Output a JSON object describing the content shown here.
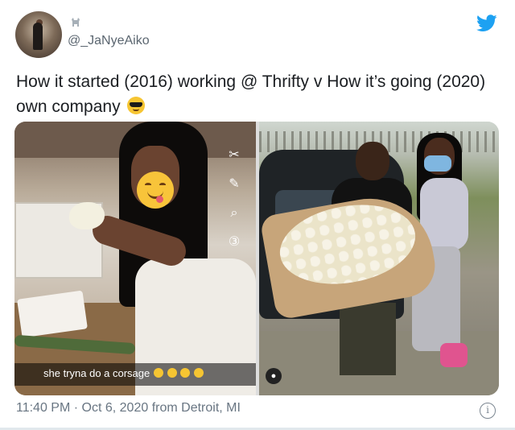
{
  "author": {
    "handle": "@_JaNyeAiko",
    "avatar_icon": "profile-photo",
    "badge_icon": "goat-emoji"
  },
  "tweet": {
    "text": "How it started (2016) working @ Thrifty v How it’s going (2020) own company",
    "emoji": "smiling-face-with-sunglasses"
  },
  "media": {
    "left": {
      "caption": "she tryna do a corsage",
      "caption_emojis": 4,
      "snapchat_tools": [
        "✂",
        "✎",
        "⌕",
        "③"
      ]
    },
    "right": {
      "user_icon": "person-icon"
    }
  },
  "meta": {
    "time": "11:40 PM",
    "separator": "·",
    "date": "Oct 6, 2020",
    "location": "from Detroit, MI"
  },
  "colors": {
    "twitter_blue": "#1da1f2",
    "meta_gray": "#687582"
  }
}
